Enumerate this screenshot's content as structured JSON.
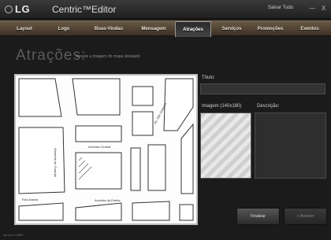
{
  "window": {
    "brand": "LG",
    "title": "Centric™Editor",
    "save_all": "Salvar Tudo",
    "minimize": "—",
    "close": "X"
  },
  "nav": {
    "items": [
      {
        "label": "Layout"
      },
      {
        "label": "Logo"
      },
      {
        "label": "Boas-Vindas"
      },
      {
        "label": "Mensagem"
      },
      {
        "label": "Atrações",
        "active": true
      },
      {
        "label": "Serviços"
      },
      {
        "label": "Promoções"
      },
      {
        "label": "Eventos"
      }
    ]
  },
  "page": {
    "title": "Atrações:",
    "subtitle": "Arraste a imagem do mapa desejado"
  },
  "map": {
    "streets": {
      "avenida_central": "Avenida Central",
      "alameda": "Alameda do Guarujá",
      "av_sao_joaquim": "Av. São Joaquim",
      "rua_acacia": "Rua Acácia",
      "avenida_direita": "Avenida da Direita"
    }
  },
  "form": {
    "title_label": "Título:",
    "title_value": "",
    "image_label": "Imagem (140x180)",
    "description_label": "Descrição:",
    "description_value": ""
  },
  "buttons": {
    "finish": "Finalizar",
    "back": "< Anterior"
  },
  "footer": {
    "version": "ver.ver 2.0000"
  },
  "colors": {
    "nav_bar": "#4f4234",
    "background": "#1b1b1b",
    "heading": "#5b5b5b"
  }
}
